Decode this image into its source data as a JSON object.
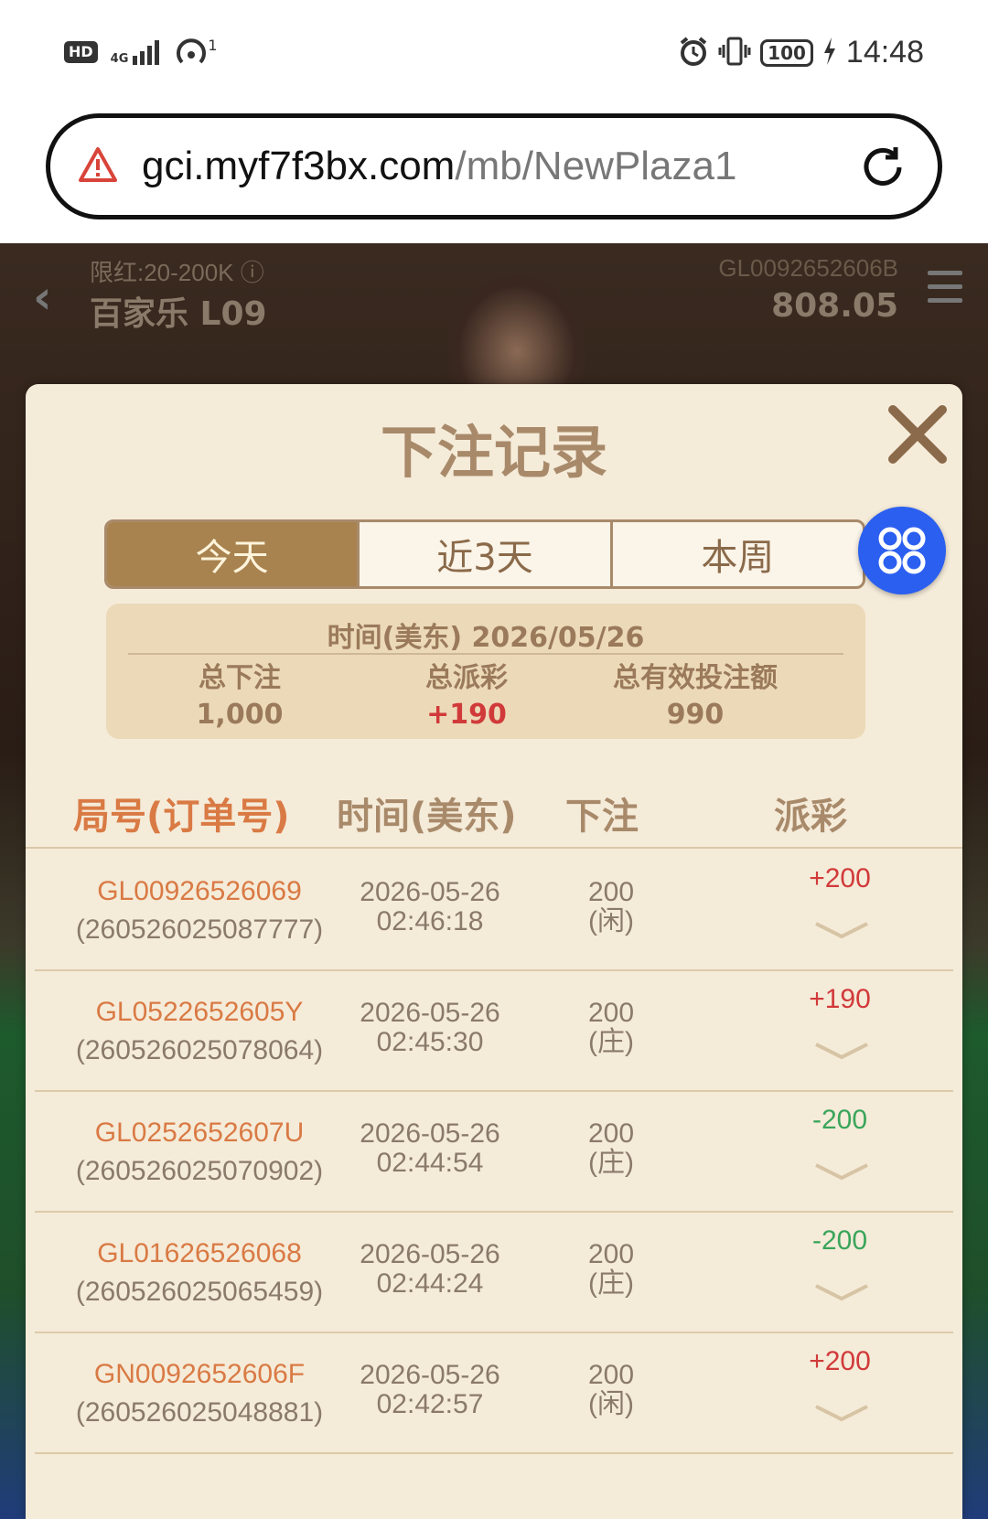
{
  "status_bar": {
    "hd": "HD",
    "signal": "4G",
    "hotspot_count": "1",
    "battery": "100",
    "time": "14:48"
  },
  "url_bar": {
    "domain": "gci.myf7f3bx.com",
    "path": "/mb/NewPlaza1"
  },
  "game_header": {
    "limit": "限红:20-200K",
    "table": "百家乐 L09",
    "round_id": "GL0092652606B",
    "balance": "808.05"
  },
  "modal": {
    "title": "下注记录",
    "tabs": [
      "今天",
      "近3天",
      "本周"
    ],
    "active_tab": 0,
    "summary": {
      "date_line": "时间(美东) 2026/05/26",
      "total_bet_label": "总下注",
      "total_bet": "1,000",
      "total_payout_label": "总派彩",
      "total_payout": "+190",
      "total_valid_label": "总有效投注额",
      "total_valid": "990"
    },
    "columns": [
      "局号(订单号)",
      "时间(美东)",
      "下注",
      "派彩"
    ],
    "rows": [
      {
        "id": "GL00926526069",
        "order": "(260526025087777)",
        "date": "2026-05-26",
        "time": "02:46:18",
        "bet": "200",
        "side": "(闲)",
        "payout": "+200",
        "result": "win"
      },
      {
        "id": "GL0522652605Y",
        "order": "(260526025078064)",
        "date": "2026-05-26",
        "time": "02:45:30",
        "bet": "200",
        "side": "(庄)",
        "payout": "+190",
        "result": "win"
      },
      {
        "id": "GL0252652607U",
        "order": "(260526025070902)",
        "date": "2026-05-26",
        "time": "02:44:54",
        "bet": "200",
        "side": "(庄)",
        "payout": "-200",
        "result": "loss"
      },
      {
        "id": "GL01626526068",
        "order": "(260526025065459)",
        "date": "2026-05-26",
        "time": "02:44:24",
        "bet": "200",
        "side": "(庄)",
        "payout": "-200",
        "result": "loss"
      },
      {
        "id": "GN0092652606F",
        "order": "(260526025048881)",
        "date": "2026-05-26",
        "time": "02:42:57",
        "bet": "200",
        "side": "(闲)",
        "payout": "+200",
        "result": "win"
      }
    ]
  },
  "colors": {
    "accent_gold": "#a8834f",
    "win_red": "#d13a3a",
    "loss_green": "#3aa55a",
    "float_blue": "#2b5ff0"
  }
}
